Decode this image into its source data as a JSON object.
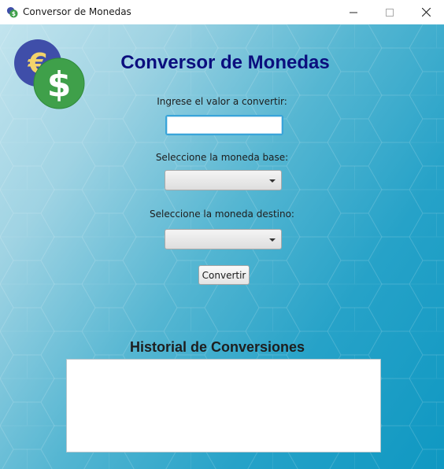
{
  "window": {
    "title": "Conversor de Monedas",
    "icon": "currency-exchange-icon",
    "controls": [
      "minimize-icon",
      "maximize-icon",
      "close-icon"
    ]
  },
  "header": {
    "title": "Conversor de Monedas",
    "logo": "currency-euro-dollar-icon"
  },
  "form": {
    "amount_label": "Ingrese el valor a convertir:",
    "amount_value": "",
    "base_label": "Seleccione la moneda base:",
    "base_selected": "",
    "target_label": "Seleccione la moneda destino:",
    "target_selected": "",
    "convert_button": "Convertir"
  },
  "history": {
    "title": "Historial de Conversiones",
    "entries": []
  },
  "colors": {
    "title": "#0b0e7e",
    "focus_border": "#39a4d9",
    "euro_coin": "#3f4ea9",
    "dollar_coin": "#3fa04a",
    "background_gradient_end": "#0f98c2"
  }
}
